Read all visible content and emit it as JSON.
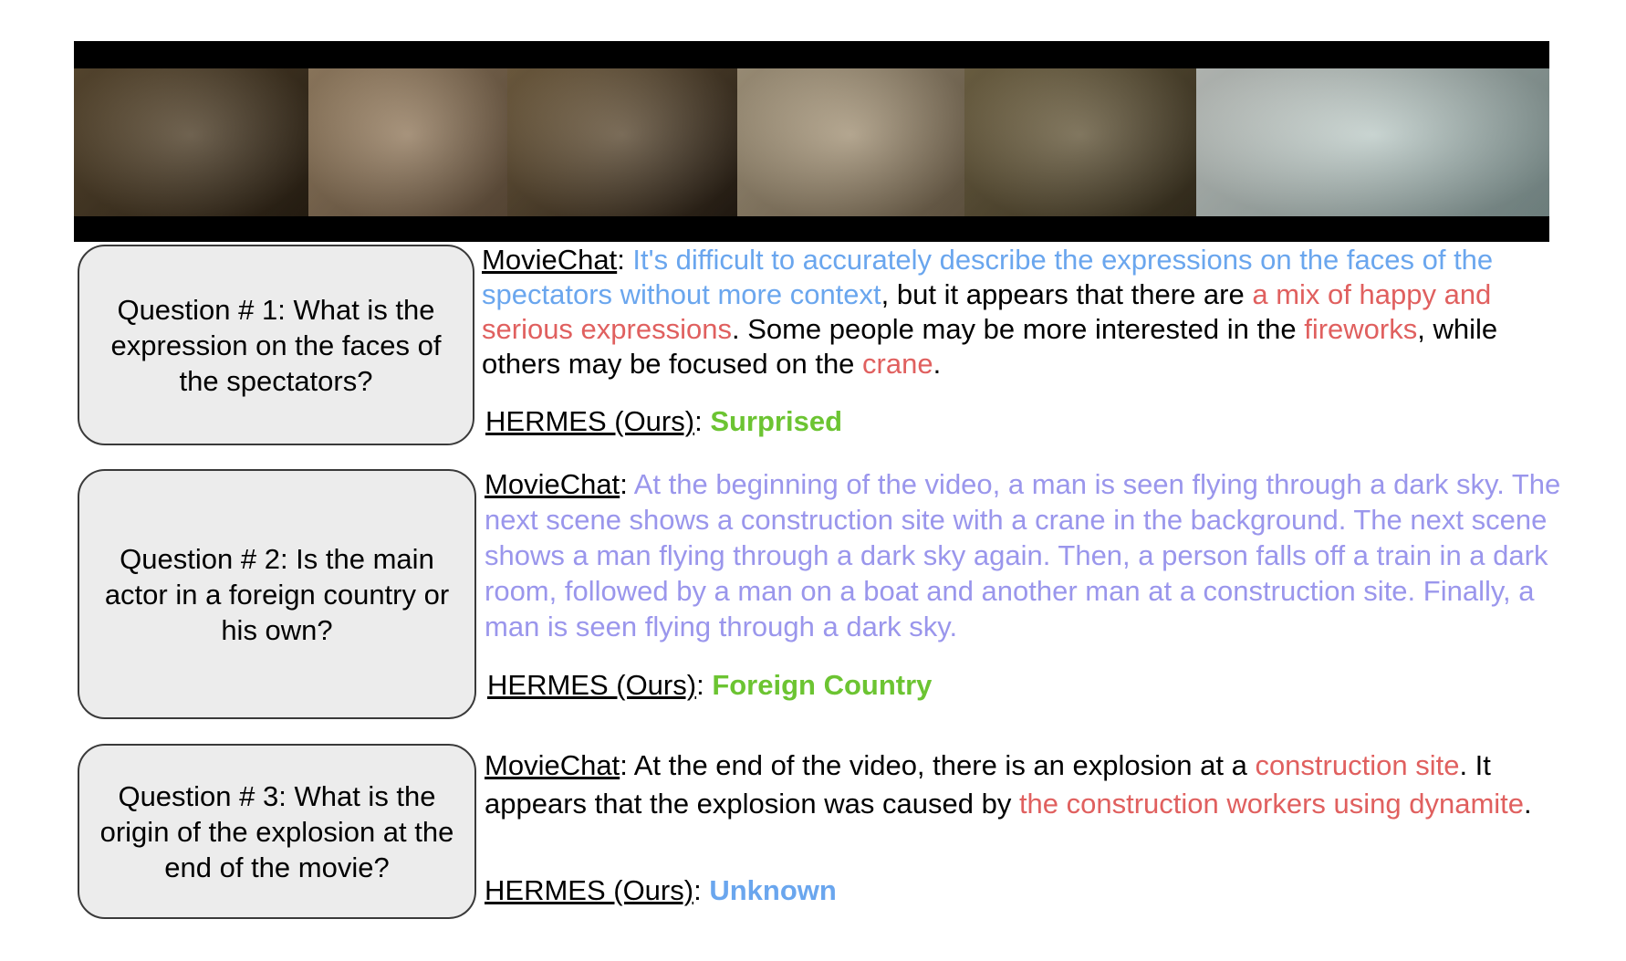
{
  "colors": {
    "filmstrip_bg": "#000000",
    "box_bg": "#ececec",
    "box_border": "#3a3a3a",
    "uncertain_blue": "#6aa6ee",
    "wrong_red": "#e0605f",
    "hallucination_purple": "#9a96ec",
    "correct_green": "#6cc432"
  },
  "filmstrip": {
    "frames": [
      {
        "tone_a": "#6e5a3c",
        "tone_b": "#2f2416"
      },
      {
        "tone_a": "#b59a78",
        "tone_b": "#6f5a44"
      },
      {
        "tone_a": "#8c7450",
        "tone_b": "#2a2016"
      },
      {
        "tone_a": "#c9b89a",
        "tone_b": "#7a6a52"
      },
      {
        "tone_a": "#8a7a55",
        "tone_b": "#3e3522"
      },
      {
        "tone_a": "#e8ede8",
        "tone_b": "#8fa6a4"
      }
    ]
  },
  "questions": [
    {
      "text": "Question # 1: What is the expression on the faces of the spectators?",
      "moviechat_label": "MovieChat",
      "moviechat_segments": [
        {
          "text": ": ",
          "cls": ""
        },
        {
          "text": "It's difficult to accurately describe the expressions on the faces of the spectators without more context",
          "cls": "blue"
        },
        {
          "text": ", but it appears that there are ",
          "cls": ""
        },
        {
          "text": "a mix of happy and serious expressions",
          "cls": "red"
        },
        {
          "text": ". Some people may be more interested in the ",
          "cls": ""
        },
        {
          "text": "fireworks",
          "cls": "red"
        },
        {
          "text": ", while others may be focused on the ",
          "cls": ""
        },
        {
          "text": "crane",
          "cls": "red"
        },
        {
          "text": ".",
          "cls": ""
        }
      ],
      "hermes_label": "HERMES (Ours)",
      "hermes_answer": "Surprised",
      "hermes_cls": "green"
    },
    {
      "text": "Question # 2: Is the main actor in a foreign country or his own?",
      "moviechat_label": "MovieChat",
      "moviechat_segments": [
        {
          "text": ": ",
          "cls": ""
        },
        {
          "text": "At the beginning of the video, a man is seen flying through a dark sky. The next scene shows a construction site with a crane in the background. The next scene shows a man flying through a dark sky again. Then, a person falls off a train in a dark room, followed by a man on a boat and another man at a construction site. Finally, a man is seen flying through a dark sky.",
          "cls": "purple"
        }
      ],
      "hermes_label": "HERMES (Ours)",
      "hermes_answer": "Foreign Country",
      "hermes_cls": "green"
    },
    {
      "text": "Question # 3: What is the origin of the explosion at the end of the movie?",
      "moviechat_label": "MovieChat",
      "moviechat_segments": [
        {
          "text": ": At the end of the video, there is an explosion at a ",
          "cls": ""
        },
        {
          "text": "construction site",
          "cls": "red"
        },
        {
          "text": ". It appears that the explosion was caused by ",
          "cls": ""
        },
        {
          "text": "the construction workers using dynamite",
          "cls": "red"
        },
        {
          "text": ".",
          "cls": ""
        }
      ],
      "hermes_label": "HERMES (Ours)",
      "hermes_answer": "Unknown",
      "hermes_cls": "hblue"
    }
  ]
}
